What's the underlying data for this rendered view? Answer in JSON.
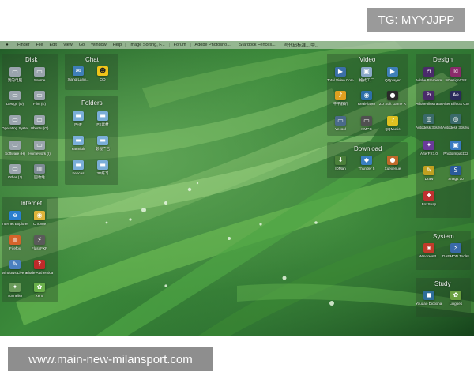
{
  "watermark": {
    "tag": "TG: MYYJJPP",
    "url": "www.main-new-milansport.com"
  },
  "menubar": {
    "items": [
      "Finder",
      "File",
      "Edit",
      "View",
      "Go",
      "Window",
      "Help"
    ],
    "tasks": [
      "Image Sorting, F...",
      "Forum",
      "Adobe Photosho...",
      "Stardock Fences...",
      "与代码标准... 中..."
    ]
  },
  "groups": {
    "disk": {
      "title": "Disk",
      "items": [
        "我的电脑",
        "Sonme",
        "Design (D)",
        "Film (E)",
        "Operating System (F)",
        "Ubuntu (G)",
        "Software (H)",
        "Homework (I)",
        "Other (J)",
        "回收站"
      ]
    },
    "chat": {
      "title": "Chat",
      "items": [
        "Xiang Lang...",
        "QQ"
      ]
    },
    "folders": {
      "title": "Folders",
      "items": [
        "PHP",
        "PS素材",
        "Farmfolt",
        "影视广告",
        "Fences",
        "3D练习"
      ]
    },
    "video": {
      "title": "Video",
      "items": [
        "Total Video Converter",
        "格式工厂",
        "QQplayer",
        "千千静听",
        "RealPlayer",
        "ZD Soft Game Recorder",
        "Vecool",
        "KMPC",
        "QQMusic"
      ]
    },
    "download": {
      "title": "Download",
      "items": [
        "IDMan",
        "Thunder 5",
        "Xuexenue"
      ]
    },
    "design": {
      "title": "Design",
      "items": [
        "Adobe Premiere ...",
        "InDesignCS2",
        "Adobe Illustrator",
        "After Effects CS4",
        "Autodesk 3ds Max 9",
        "Autodesk 3ds Max 9",
        "AfterFX7.0",
        "PhotoImpactX2",
        "Draw",
        "Snagit 10",
        "FoxSnap"
      ]
    },
    "internet": {
      "title": "Internet",
      "items": [
        "Internet Explorer",
        "Chrome",
        "Firefox",
        "FlashFXP",
        "Windows Live Writer",
        "Flude Authenticat...",
        "Tunnelier",
        "Xenu"
      ]
    },
    "system": {
      "title": "System",
      "items": [
        "WindowsP...",
        "DAEMON Tools Lite"
      ]
    },
    "study": {
      "title": "Study",
      "items": [
        "Youdao Dictionar",
        "Lingoes"
      ]
    }
  },
  "colors": {
    "disk": "#9aa4ad",
    "chat": "#3f7fb8",
    "folders": "#7aaed8",
    "video": "#3b6fa8",
    "download": "#4b7f3a",
    "design": "#7e3d8c",
    "internet": "#d4632a",
    "system": "#c23b2a",
    "study": "#2f6e9a"
  }
}
